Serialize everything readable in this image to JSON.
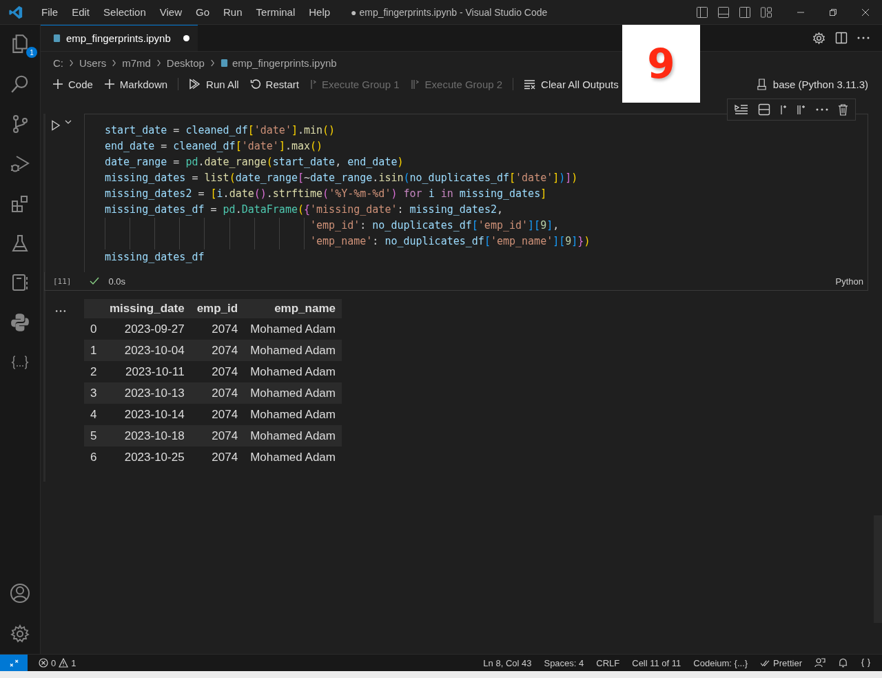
{
  "menu": [
    "File",
    "Edit",
    "Selection",
    "View",
    "Go",
    "Run",
    "Terminal",
    "Help"
  ],
  "window_title": "● emp_fingerprints.ipynb - Visual Studio Code",
  "activity_badge": "1",
  "tab": {
    "label": "emp_fingerprints.ipynb",
    "modified": true
  },
  "breadcrumb": [
    "C:",
    "Users",
    "m7md",
    "Desktop",
    "emp_fingerprints.ipynb"
  ],
  "toolbar": [
    {
      "kind": "plus",
      "label": "Code",
      "disabled": false
    },
    {
      "kind": "plus",
      "label": "Markdown",
      "disabled": false
    },
    {
      "kind": "runall",
      "label": "Run All",
      "disabled": false
    },
    {
      "kind": "restart",
      "label": "Restart",
      "disabled": false
    },
    {
      "kind": "group1",
      "label": "Execute Group 1",
      "disabled": true
    },
    {
      "kind": "group2",
      "label": "Execute Group 2",
      "disabled": true
    },
    {
      "kind": "clear",
      "label": "Clear All Outputs",
      "disabled": false
    }
  ],
  "kernel": "base (Python 3.11.3)",
  "overlay_number": "9",
  "cell": {
    "exec_count": "[11]",
    "duration": "0.0s",
    "language": "Python",
    "lines": [
      {
        "indented": false,
        "tokens": [
          {
            "kind": "var",
            "text": "start_date"
          },
          {
            "kind": "op",
            "text": " = "
          },
          {
            "kind": "var",
            "text": "cleaned_df"
          },
          {
            "kind": "b1",
            "text": "["
          },
          {
            "kind": "str",
            "text": "'date'"
          },
          {
            "kind": "b1",
            "text": "]"
          },
          {
            "kind": "op",
            "text": "."
          },
          {
            "kind": "fn",
            "text": "min"
          },
          {
            "kind": "b1",
            "text": "()"
          }
        ]
      },
      {
        "indented": false,
        "tokens": [
          {
            "kind": "var",
            "text": "end_date"
          },
          {
            "kind": "op",
            "text": " = "
          },
          {
            "kind": "var",
            "text": "cleaned_df"
          },
          {
            "kind": "b1",
            "text": "["
          },
          {
            "kind": "str",
            "text": "'date'"
          },
          {
            "kind": "b1",
            "text": "]"
          },
          {
            "kind": "op",
            "text": "."
          },
          {
            "kind": "fn",
            "text": "max"
          },
          {
            "kind": "b1",
            "text": "()"
          }
        ]
      },
      {
        "indented": false,
        "tokens": [
          {
            "kind": "var",
            "text": "date_range"
          },
          {
            "kind": "op",
            "text": " = "
          },
          {
            "kind": "cls",
            "text": "pd"
          },
          {
            "kind": "op",
            "text": "."
          },
          {
            "kind": "fn",
            "text": "date_range"
          },
          {
            "kind": "b1",
            "text": "("
          },
          {
            "kind": "var",
            "text": "start_date"
          },
          {
            "kind": "op",
            "text": ", "
          },
          {
            "kind": "var",
            "text": "end_date"
          },
          {
            "kind": "b1",
            "text": ")"
          }
        ]
      },
      {
        "indented": false,
        "tokens": [
          {
            "kind": "var",
            "text": "missing_dates"
          },
          {
            "kind": "op",
            "text": " = "
          },
          {
            "kind": "fn",
            "text": "list"
          },
          {
            "kind": "b1",
            "text": "("
          },
          {
            "kind": "var",
            "text": "date_range"
          },
          {
            "kind": "b2",
            "text": "["
          },
          {
            "kind": "op",
            "text": "~"
          },
          {
            "kind": "var",
            "text": "date_range"
          },
          {
            "kind": "op",
            "text": "."
          },
          {
            "kind": "fn",
            "text": "isin"
          },
          {
            "kind": "b3",
            "text": "("
          },
          {
            "kind": "var",
            "text": "no_duplicates_df"
          },
          {
            "kind": "b1",
            "text": "["
          },
          {
            "kind": "str",
            "text": "'date'"
          },
          {
            "kind": "b1",
            "text": "]"
          },
          {
            "kind": "b3",
            "text": ")"
          },
          {
            "kind": "b2",
            "text": "]"
          },
          {
            "kind": "b1",
            "text": ")"
          }
        ]
      },
      {
        "indented": false,
        "tokens": [
          {
            "kind": "var",
            "text": "missing_dates2"
          },
          {
            "kind": "op",
            "text": " = "
          },
          {
            "kind": "b1",
            "text": "["
          },
          {
            "kind": "var",
            "text": "i"
          },
          {
            "kind": "op",
            "text": "."
          },
          {
            "kind": "fn",
            "text": "date"
          },
          {
            "kind": "b2",
            "text": "()"
          },
          {
            "kind": "op",
            "text": "."
          },
          {
            "kind": "fn",
            "text": "strftime"
          },
          {
            "kind": "b2",
            "text": "("
          },
          {
            "kind": "str",
            "text": "'%Y-%m-%d'"
          },
          {
            "kind": "b2",
            "text": ")"
          },
          {
            "kind": "kw",
            "text": " for "
          },
          {
            "kind": "var",
            "text": "i"
          },
          {
            "kind": "kw",
            "text": " in "
          },
          {
            "kind": "var",
            "text": "missing_dates"
          },
          {
            "kind": "b1",
            "text": "]"
          }
        ]
      },
      {
        "indented": false,
        "tokens": [
          {
            "kind": "var",
            "text": "missing_dates_df"
          },
          {
            "kind": "op",
            "text": " = "
          },
          {
            "kind": "cls",
            "text": "pd"
          },
          {
            "kind": "op",
            "text": "."
          },
          {
            "kind": "cls",
            "text": "DataFrame"
          },
          {
            "kind": "b1",
            "text": "("
          },
          {
            "kind": "b2",
            "text": "{"
          },
          {
            "kind": "str",
            "text": "'missing_date'"
          },
          {
            "kind": "op",
            "text": ": "
          },
          {
            "kind": "var",
            "text": "missing_dates2"
          },
          {
            "kind": "op",
            "text": ","
          }
        ]
      },
      {
        "indented": true,
        "tokens": [
          {
            "kind": "str",
            "text": "'emp_id'"
          },
          {
            "kind": "op",
            "text": ": "
          },
          {
            "kind": "var",
            "text": "no_duplicates_df"
          },
          {
            "kind": "b3",
            "text": "["
          },
          {
            "kind": "str",
            "text": "'emp_id'"
          },
          {
            "kind": "b3",
            "text": "]["
          },
          {
            "kind": "num",
            "text": "9"
          },
          {
            "kind": "b3",
            "text": "]"
          },
          {
            "kind": "op",
            "text": ","
          }
        ]
      },
      {
        "indented": true,
        "tokens": [
          {
            "kind": "str",
            "text": "'emp_name'"
          },
          {
            "kind": "op",
            "text": ": "
          },
          {
            "kind": "var",
            "text": "no_duplicates_df"
          },
          {
            "kind": "b3",
            "text": "["
          },
          {
            "kind": "str",
            "text": "'emp_name'"
          },
          {
            "kind": "b3",
            "text": "]["
          },
          {
            "kind": "num",
            "text": "9"
          },
          {
            "kind": "b3",
            "text": "]"
          },
          {
            "kind": "b2",
            "text": "}"
          },
          {
            "kind": "b1",
            "text": ")"
          }
        ]
      },
      {
        "indented": false,
        "tokens": [
          {
            "kind": "var",
            "text": "missing_dates_df"
          }
        ]
      }
    ]
  },
  "output": {
    "columns": [
      "missing_date",
      "emp_id",
      "emp_name"
    ],
    "rows": [
      {
        "index": "0",
        "cells": [
          "2023-09-27",
          "2074",
          "Mohamed Adam"
        ]
      },
      {
        "index": "1",
        "cells": [
          "2023-10-04",
          "2074",
          "Mohamed Adam"
        ]
      },
      {
        "index": "2",
        "cells": [
          "2023-10-11",
          "2074",
          "Mohamed Adam"
        ]
      },
      {
        "index": "3",
        "cells": [
          "2023-10-13",
          "2074",
          "Mohamed Adam"
        ]
      },
      {
        "index": "4",
        "cells": [
          "2023-10-14",
          "2074",
          "Mohamed Adam"
        ]
      },
      {
        "index": "5",
        "cells": [
          "2023-10-18",
          "2074",
          "Mohamed Adam"
        ]
      },
      {
        "index": "6",
        "cells": [
          "2023-10-25",
          "2074",
          "Mohamed Adam"
        ]
      }
    ]
  },
  "status_bar": {
    "errors": "0",
    "warnings": "1",
    "items": [
      "Ln 8, Col 43",
      "Spaces: 4",
      "CRLF",
      "Cell 11 of 11",
      "Codeium: {...}"
    ],
    "prettier": "Prettier"
  }
}
